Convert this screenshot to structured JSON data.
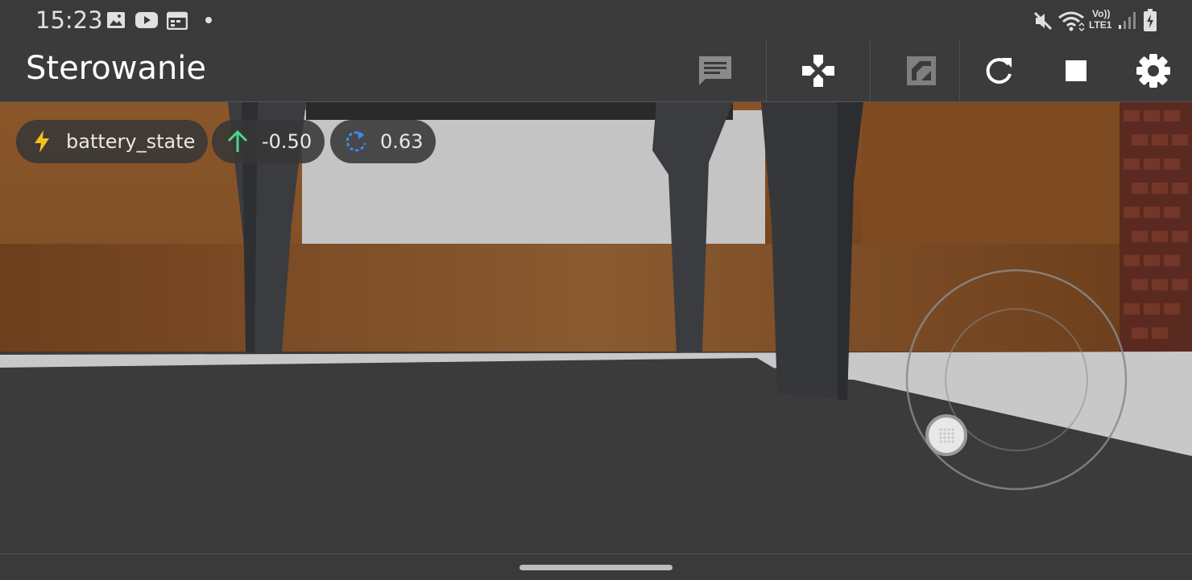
{
  "status_bar": {
    "time": "15:23",
    "left_icons": [
      "image-icon",
      "youtube-icon",
      "calendar-icon",
      "dot-icon"
    ],
    "right_icons": [
      "mute-icon",
      "wifi-icon",
      "volte-icon",
      "signal-icon",
      "battery-charging-icon"
    ],
    "volte_label": "Vo))",
    "lte_label": "LTE1"
  },
  "app_bar": {
    "title": "Sterowanie",
    "actions": [
      "chat-icon",
      "gamepad-icon",
      "map-icon",
      "refresh-icon",
      "stop-icon",
      "settings-icon"
    ]
  },
  "chips": [
    {
      "icon": "bolt-icon",
      "label": "battery_state",
      "color": "#f5c21b"
    },
    {
      "icon": "arrow-up-icon",
      "label": "-0.50",
      "color": "#4cd68a"
    },
    {
      "icon": "rotate-icon",
      "label": "0.63",
      "color": "#3d8bf2"
    }
  ],
  "joystick": {
    "label": "joystick"
  }
}
